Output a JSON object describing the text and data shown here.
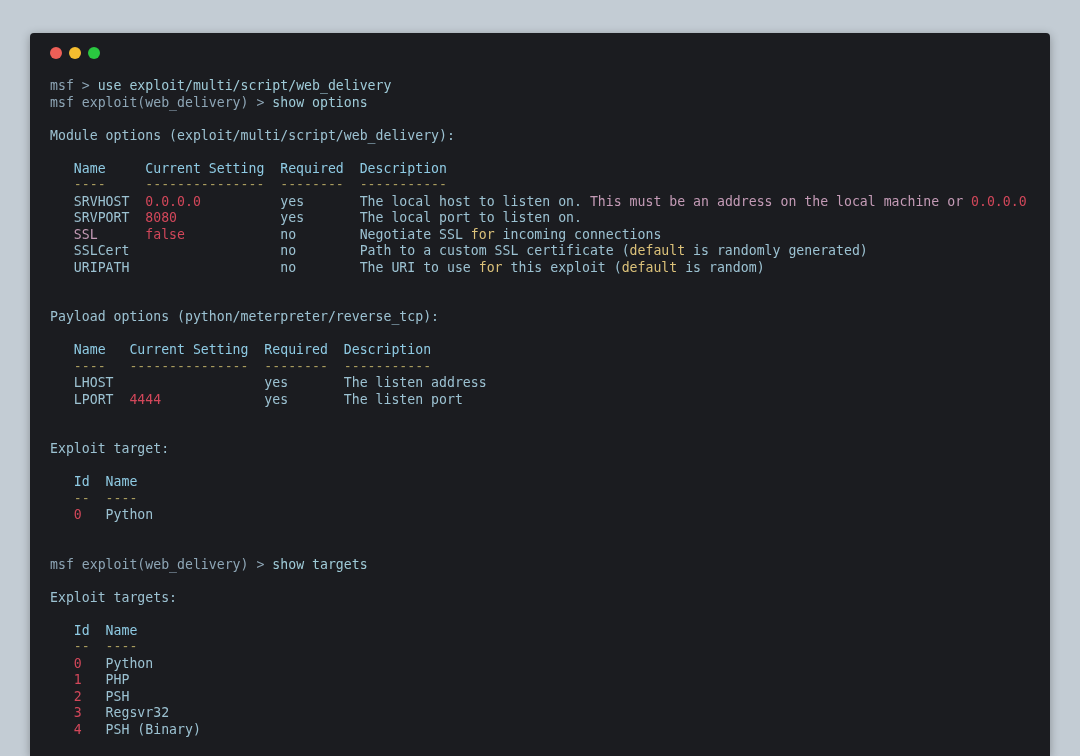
{
  "window": {
    "controls": [
      {
        "kind": "close"
      },
      {
        "kind": "minimize"
      },
      {
        "kind": "zoom"
      }
    ]
  },
  "terminal": {
    "lines": [
      {
        "kind": "text",
        "indent": false,
        "segments": [
          {
            "kind": "prompt",
            "text": "msf > "
          },
          {
            "kind": "cmd",
            "text": "use exploit/multi/script/web_delivery"
          }
        ]
      },
      {
        "kind": "text",
        "indent": false,
        "segments": [
          {
            "kind": "prompt",
            "text": "msf exploit(web_delivery) > "
          },
          {
            "kind": "cmd",
            "text": "show options"
          }
        ]
      },
      {
        "kind": "blank"
      },
      {
        "kind": "text",
        "indent": false,
        "segments": [
          {
            "kind": "plain",
            "text": "Module options (exploit/multi/script/web_delivery):"
          }
        ]
      },
      {
        "kind": "blank"
      },
      {
        "kind": "text",
        "indent": true,
        "segments": [
          {
            "kind": "head",
            "text": "Name     Current Setting  Required  Description"
          }
        ]
      },
      {
        "kind": "text",
        "indent": true,
        "segments": [
          {
            "kind": "rule",
            "text": "----     ---------------  --------  -----------"
          }
        ]
      },
      {
        "kind": "text",
        "indent": true,
        "segments": [
          {
            "kind": "plain",
            "text": "SRVHOST  "
          },
          {
            "kind": "red",
            "text": "0.0.0.0"
          },
          {
            "kind": "plain",
            "text": "          yes       The local host to listen on. "
          },
          {
            "kind": "pink",
            "text": "This must be an address on the local machine or "
          },
          {
            "kind": "red",
            "text": "0.0.0.0"
          }
        ]
      },
      {
        "kind": "text",
        "indent": true,
        "segments": [
          {
            "kind": "plain",
            "text": "SRVPORT  "
          },
          {
            "kind": "red",
            "text": "8080"
          },
          {
            "kind": "plain",
            "text": "             yes       The local port to listen on."
          }
        ]
      },
      {
        "kind": "text",
        "indent": true,
        "segments": [
          {
            "kind": "pink",
            "text": "SSL      "
          },
          {
            "kind": "red",
            "text": "false"
          },
          {
            "kind": "plain",
            "text": "            no        Negotiate SSL "
          },
          {
            "kind": "yellow",
            "text": "for"
          },
          {
            "kind": "plain",
            "text": " incoming connections"
          }
        ]
      },
      {
        "kind": "text",
        "indent": true,
        "segments": [
          {
            "kind": "plain",
            "text": "SSLCert                   no        Path to a custom SSL certificate ("
          },
          {
            "kind": "yellow",
            "text": "default"
          },
          {
            "kind": "plain",
            "text": " is randomly generated)"
          }
        ]
      },
      {
        "kind": "text",
        "indent": true,
        "segments": [
          {
            "kind": "plain",
            "text": "URIPATH                   no        The URI to use "
          },
          {
            "kind": "yellow",
            "text": "for"
          },
          {
            "kind": "plain",
            "text": " this exploit ("
          },
          {
            "kind": "yellow",
            "text": "default"
          },
          {
            "kind": "plain",
            "text": " is random)"
          }
        ]
      },
      {
        "kind": "blank"
      },
      {
        "kind": "blank"
      },
      {
        "kind": "text",
        "indent": false,
        "segments": [
          {
            "kind": "plain",
            "text": "Payload options (python/meterpreter/reverse_tcp):"
          }
        ]
      },
      {
        "kind": "blank"
      },
      {
        "kind": "text",
        "indent": true,
        "segments": [
          {
            "kind": "head",
            "text": "Name   Current Setting  Required  Description"
          }
        ]
      },
      {
        "kind": "text",
        "indent": true,
        "segments": [
          {
            "kind": "rule",
            "text": "----   ---------------  --------  -----------"
          }
        ]
      },
      {
        "kind": "text",
        "indent": true,
        "segments": [
          {
            "kind": "plain",
            "text": "LHOST                   yes       The listen address"
          }
        ]
      },
      {
        "kind": "text",
        "indent": true,
        "segments": [
          {
            "kind": "plain",
            "text": "LPORT  "
          },
          {
            "kind": "red",
            "text": "4444"
          },
          {
            "kind": "plain",
            "text": "             yes       The listen port"
          }
        ]
      },
      {
        "kind": "blank"
      },
      {
        "kind": "blank"
      },
      {
        "kind": "text",
        "indent": false,
        "segments": [
          {
            "kind": "plain",
            "text": "Exploit target:"
          }
        ]
      },
      {
        "kind": "blank"
      },
      {
        "kind": "text",
        "indent": true,
        "segments": [
          {
            "kind": "head",
            "text": "Id  Name"
          }
        ]
      },
      {
        "kind": "text",
        "indent": true,
        "segments": [
          {
            "kind": "rule",
            "text": "--  ----"
          }
        ]
      },
      {
        "kind": "text",
        "indent": true,
        "segments": [
          {
            "kind": "red",
            "text": "0"
          },
          {
            "kind": "plain",
            "text": "   Python"
          }
        ]
      },
      {
        "kind": "blank"
      },
      {
        "kind": "blank"
      },
      {
        "kind": "text",
        "indent": false,
        "segments": [
          {
            "kind": "prompt",
            "text": "msf exploit(web_delivery) > "
          },
          {
            "kind": "cmd",
            "text": "show targets"
          }
        ]
      },
      {
        "kind": "blank"
      },
      {
        "kind": "text",
        "indent": false,
        "segments": [
          {
            "kind": "plain",
            "text": "Exploit targets:"
          }
        ]
      },
      {
        "kind": "blank"
      },
      {
        "kind": "text",
        "indent": true,
        "segments": [
          {
            "kind": "head",
            "text": "Id  Name"
          }
        ]
      },
      {
        "kind": "text",
        "indent": true,
        "segments": [
          {
            "kind": "rule",
            "text": "--  ----"
          }
        ]
      },
      {
        "kind": "text",
        "indent": true,
        "segments": [
          {
            "kind": "red",
            "text": "0"
          },
          {
            "kind": "plain",
            "text": "   Python"
          }
        ]
      },
      {
        "kind": "text",
        "indent": true,
        "segments": [
          {
            "kind": "red",
            "text": "1"
          },
          {
            "kind": "plain",
            "text": "   PHP"
          }
        ]
      },
      {
        "kind": "text",
        "indent": true,
        "segments": [
          {
            "kind": "red",
            "text": "2"
          },
          {
            "kind": "plain",
            "text": "   PSH"
          }
        ]
      },
      {
        "kind": "text",
        "indent": true,
        "segments": [
          {
            "kind": "red",
            "text": "3"
          },
          {
            "kind": "plain",
            "text": "   Regsvr32"
          }
        ]
      },
      {
        "kind": "text",
        "indent": true,
        "segments": [
          {
            "kind": "red",
            "text": "4"
          },
          {
            "kind": "plain",
            "text": "   PSH (Binary)"
          }
        ]
      }
    ]
  }
}
